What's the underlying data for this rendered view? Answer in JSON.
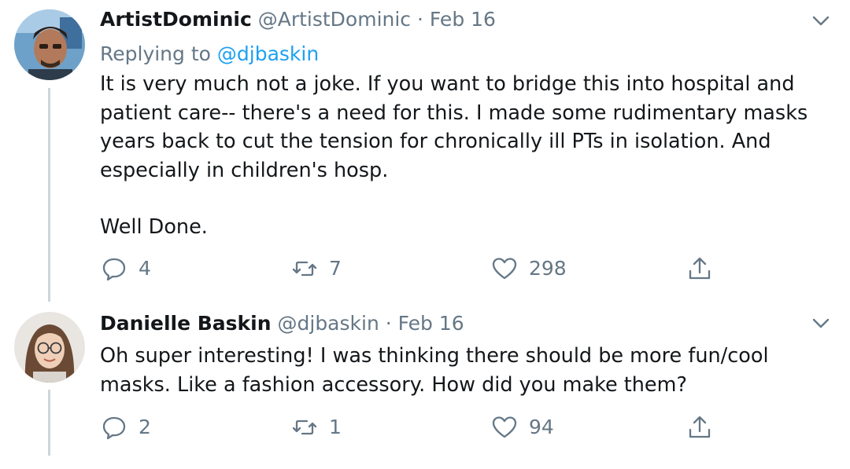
{
  "colors": {
    "accent": "#1da1f2",
    "muted": "#657786",
    "text": "#14171a",
    "thread": "#ccd6dd"
  },
  "tweets": [
    {
      "name": "ArtistDominic",
      "handle": "@ArtistDominic",
      "separator": "·",
      "date": "Feb 16",
      "replying_prefix": "Replying to",
      "replying_to": "@djbaskin",
      "body": [
        "It is very much not a joke. If you want to bridge this into hospital and",
        "patient care-- there's a need for this. I made some rudimentary masks",
        "years back to cut the tension for chronically ill PTs in isolation. And",
        "especially in children's hosp.",
        "Well Done."
      ],
      "actions": {
        "reply_count": "4",
        "retweet_count": "7",
        "like_count": "298"
      },
      "icons": [
        "reply-icon",
        "retweet-icon",
        "like-icon",
        "share-icon",
        "chevron-down-icon"
      ]
    },
    {
      "name": "Danielle Baskin",
      "handle": "@djbaskin",
      "separator": "·",
      "date": "Feb 16",
      "body": [
        "Oh super interesting! I was thinking there should be more fun/cool",
        "masks. Like a fashion accessory. How did you make them?"
      ],
      "actions": {
        "reply_count": "2",
        "retweet_count": "1",
        "like_count": "94"
      },
      "icons": [
        "reply-icon",
        "retweet-icon",
        "like-icon",
        "share-icon",
        "chevron-down-icon"
      ]
    }
  ]
}
